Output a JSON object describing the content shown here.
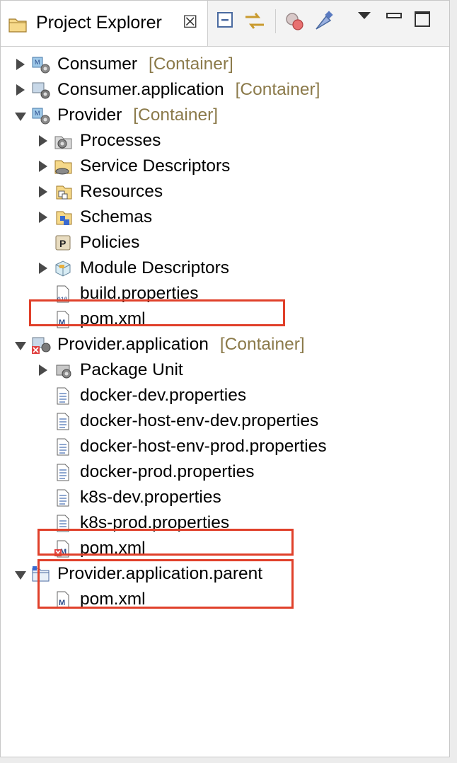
{
  "view": {
    "title": "Project Explorer",
    "close_glyph": "☒",
    "toolbar": [
      "collapse-all-icon",
      "link-with-editor-icon",
      "filter-icon",
      "customize-view-icon",
      "view-menu-icon",
      "minimize-icon",
      "maximize-icon"
    ]
  },
  "tree": {
    "decoration": "[Container]",
    "items": [
      {
        "label": "Consumer",
        "decorated": true,
        "state": "collapsed",
        "icon": "container-project-icon"
      },
      {
        "label": "Consumer.application",
        "decorated": true,
        "state": "collapsed",
        "icon": "application-project-icon"
      },
      {
        "label": "Provider",
        "decorated": true,
        "state": "expanded",
        "icon": "container-project-icon"
      },
      {
        "label": "Processes",
        "state": "collapsed",
        "icon": "processes-folder-icon"
      },
      {
        "label": "Service Descriptors",
        "state": "collapsed",
        "icon": "service-descriptors-folder-icon"
      },
      {
        "label": "Resources",
        "state": "collapsed",
        "icon": "resources-folder-icon"
      },
      {
        "label": "Schemas",
        "state": "collapsed",
        "icon": "schemas-folder-icon"
      },
      {
        "label": "Policies",
        "state": "leaf",
        "icon": "policies-icon"
      },
      {
        "label": "Module Descriptors",
        "state": "collapsed",
        "icon": "module-descriptors-icon"
      },
      {
        "label": "build.properties",
        "state": "leaf",
        "icon": "properties-file-icon"
      },
      {
        "label": "pom.xml",
        "state": "leaf",
        "icon": "maven-pom-icon"
      },
      {
        "label": "Provider.application",
        "decorated": true,
        "state": "expanded",
        "icon": "application-project-error-icon"
      },
      {
        "label": "Package Unit",
        "state": "collapsed",
        "icon": "package-unit-icon"
      },
      {
        "label": "docker-dev.properties",
        "state": "leaf",
        "icon": "text-file-icon"
      },
      {
        "label": "docker-host-env-dev.properties",
        "state": "leaf",
        "icon": "text-file-icon"
      },
      {
        "label": "docker-host-env-prod.properties",
        "state": "leaf",
        "icon": "text-file-icon"
      },
      {
        "label": "docker-prod.properties",
        "state": "leaf",
        "icon": "text-file-icon"
      },
      {
        "label": "k8s-dev.properties",
        "state": "leaf",
        "icon": "text-file-icon"
      },
      {
        "label": "k8s-prod.properties",
        "state": "leaf",
        "icon": "text-file-icon"
      },
      {
        "label": "pom.xml",
        "state": "leaf",
        "icon": "maven-pom-error-icon"
      },
      {
        "label": "Provider.application.parent",
        "state": "expanded",
        "icon": "folder-project-icon"
      },
      {
        "label": "pom.xml",
        "state": "leaf",
        "icon": "maven-pom-icon"
      }
    ]
  },
  "highlight_color": "#e0402a",
  "decoration_color": "#8b7a4a"
}
